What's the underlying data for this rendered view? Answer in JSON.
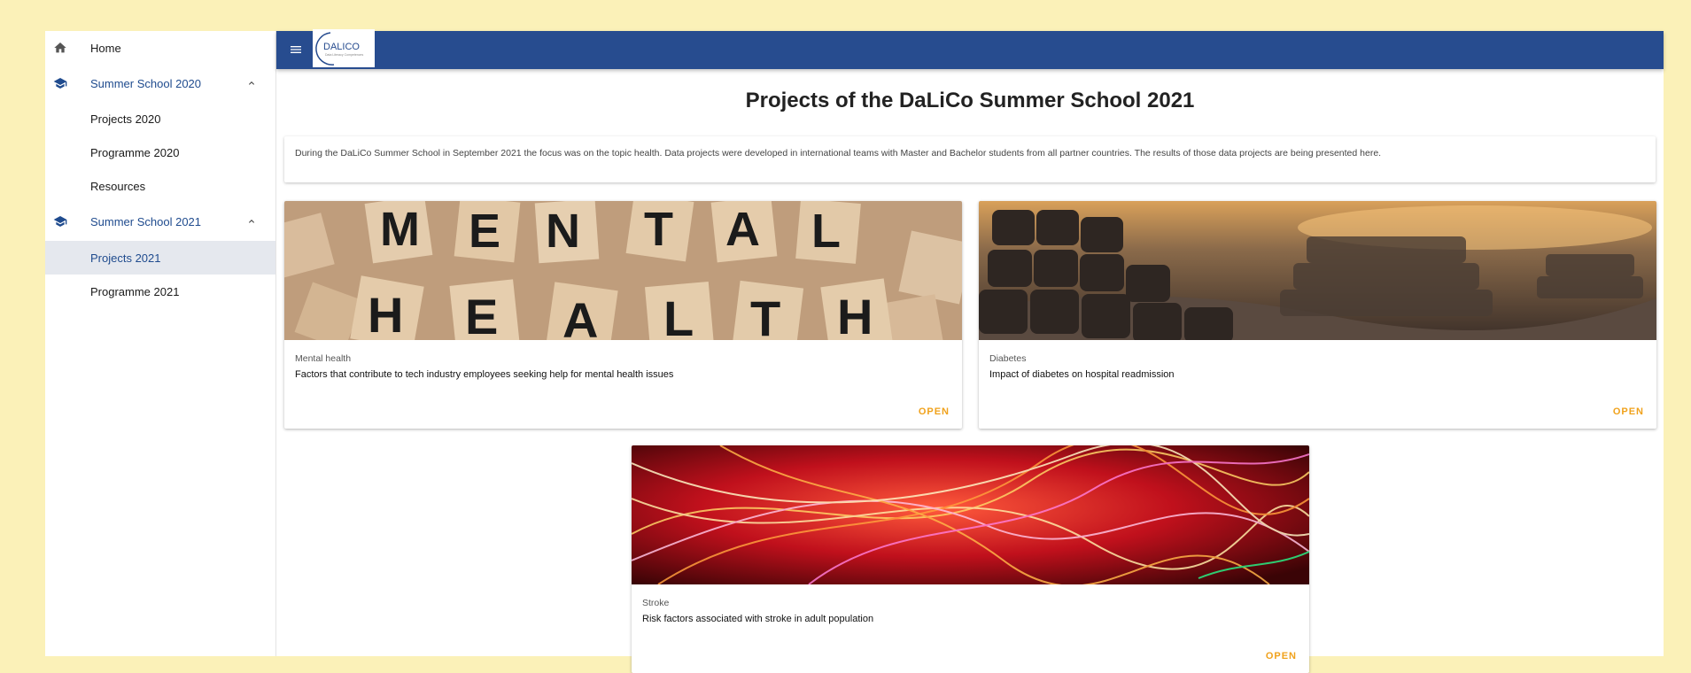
{
  "sidebar": {
    "items": [
      {
        "label": "Home",
        "icon": "home-icon"
      },
      {
        "label": "Summer School 2020",
        "icon": "graduation-cap-icon"
      },
      {
        "label": "Projects 2020"
      },
      {
        "label": "Programme 2020"
      },
      {
        "label": "Resources"
      },
      {
        "label": "Summer School 2021",
        "icon": "graduation-cap-icon"
      },
      {
        "label": "Projects 2021"
      },
      {
        "label": "Programme 2021"
      }
    ]
  },
  "header": {
    "logo_text": "DALICO",
    "logo_subtext": "Data Literacy Competences"
  },
  "main": {
    "title": "Projects of the DaLiCo Summer School 2021",
    "intro": "During the DaLiCo Summer School in September 2021 the focus was on the topic health. Data projects were developed in international teams with Master and Bachelor students from all partner countries. The results of those data projects are being presented here.",
    "cards": [
      {
        "category": "Mental health",
        "title": "Factors that contribute to tech industry employees seeking help for mental health issues",
        "action": "OPEN",
        "tiles_top": [
          "M",
          "E",
          "N",
          "T",
          "A",
          "L"
        ],
        "tiles_bottom": [
          "H",
          "E",
          "A",
          "L",
          "T",
          "H"
        ]
      },
      {
        "category": "Diabetes",
        "title": "Impact of diabetes on hospital readmission",
        "action": "OPEN"
      },
      {
        "category": "Stroke",
        "title": "Risk factors associated with stroke in adult population",
        "action": "OPEN"
      }
    ]
  },
  "colors": {
    "page_bg": "#fbf1b8",
    "topbar": "#274c8f",
    "accent": "#f0a21c",
    "nav_active": "#1f4b8e"
  }
}
